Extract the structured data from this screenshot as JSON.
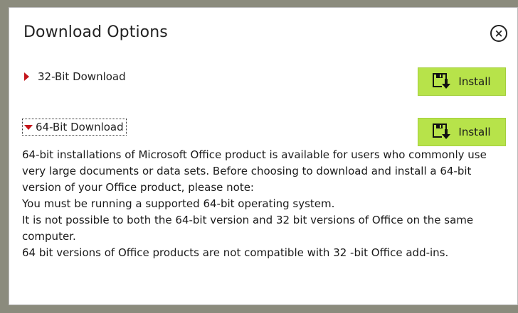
{
  "dialog": {
    "title": "Download Options",
    "close_label": "×"
  },
  "options": [
    {
      "label": "32-Bit Download",
      "expanded": false,
      "install_label": "Install"
    },
    {
      "label": "64-Bit Download",
      "expanded": true,
      "install_label": "Install"
    }
  ],
  "description": {
    "lines": [
      "64-bit installations of Microsoft Office product is available for users who commonly use very large documents or data sets. Before choosing to download and install a 64-bit version of your Office product, please note:",
      "You must be running a supported 64-bit operating system.",
      "It is not possible to both the 64-bit version and 32 bit versions of Office on the same computer.",
      "64 bit versions of Office products are not compatible with 32 -bit Office add-ins."
    ]
  },
  "colors": {
    "accent_arrow": "#c4161c",
    "install_bg": "#b7e34a"
  },
  "icons": {
    "install": "floppy-download-icon",
    "expand_collapsed": "caret-right-icon",
    "expand_open": "caret-down-icon",
    "close": "close-circle-icon"
  }
}
